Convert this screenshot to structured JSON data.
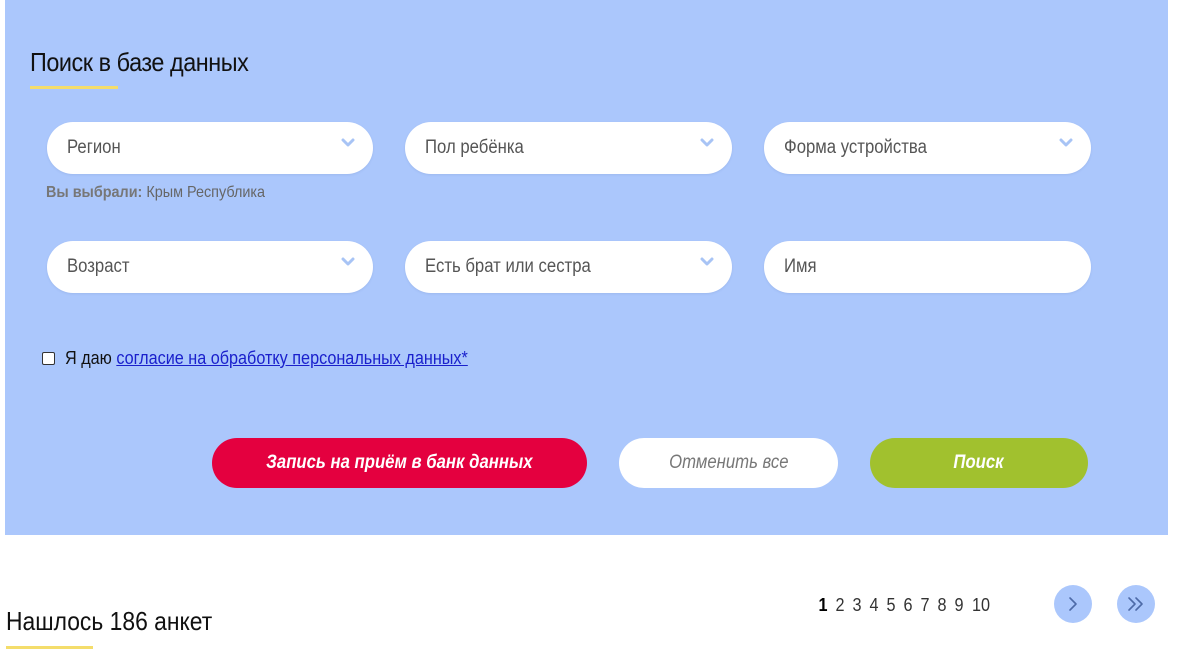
{
  "search": {
    "title": "Поиск в базе данных",
    "fields": {
      "region": "Регион",
      "gender": "Пол ребёнка",
      "placement_form": "Форма устройства",
      "age": "Возраст",
      "siblings": "Есть брат или сестра",
      "name_placeholder": "Имя"
    },
    "selected_prefix": "Вы выбрали:",
    "selected_value": "Крым Республика",
    "consent_prefix": "Я даю",
    "consent_link": "согласие на обработку персональных данных*",
    "buttons": {
      "appointment": "Запись на приём в банк данных",
      "cancel": "Отменить все",
      "search": "Поиск"
    }
  },
  "results": {
    "count_text": "Нашлось 186 анкет"
  },
  "pagination": {
    "pages": [
      "1",
      "2",
      "3",
      "4",
      "5",
      "6",
      "7",
      "8",
      "9",
      "10"
    ],
    "current": "1",
    "next_glyph": "›",
    "last_glyph": "»"
  },
  "colors": {
    "panel_bg": "#abc7fc",
    "accent_yellow": "#f4dd6b",
    "button_red": "#e4003f",
    "button_green": "#a1c12e",
    "link": "#1a20cc"
  },
  "icons": {
    "dropdown": "chevron-down-icon",
    "next_page": "chevron-right-icon",
    "last_page": "double-chevron-right-icon"
  }
}
